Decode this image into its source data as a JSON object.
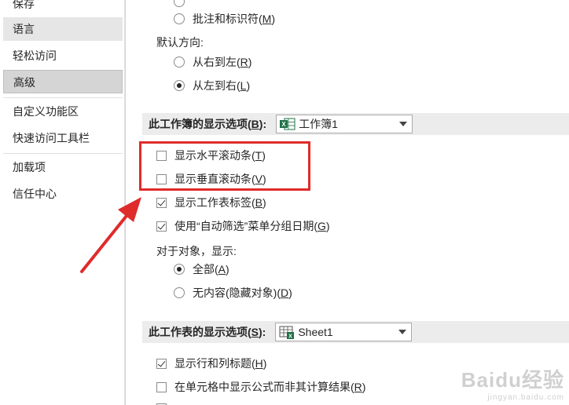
{
  "sidebar": {
    "items": [
      {
        "label": "保存"
      },
      {
        "label": "语言"
      },
      {
        "label": "轻松访问"
      },
      {
        "label": "高级"
      },
      {
        "label": "自定义功能区"
      },
      {
        "label": "快速访问工具栏"
      },
      {
        "label": "加载项"
      },
      {
        "label": "信任中心"
      }
    ]
  },
  "main": {
    "comments_option": {
      "label": "批注和标识符(",
      "key": "M",
      "suffix": ")",
      "selected": false
    },
    "default_direction_label": "默认方向:",
    "direction_rtl": {
      "label": "从右到左(",
      "key": "R",
      "suffix": ")",
      "selected": false
    },
    "direction_ltr": {
      "label": "从左到右(",
      "key": "L",
      "suffix": ")",
      "selected": true
    },
    "workbook_section": {
      "label": "此工作簿的显示选项(",
      "key": "B",
      "suffix": "):",
      "selected_value": "工作簿1"
    },
    "show_hscroll": {
      "label": "显示水平滚动条(",
      "key": "T",
      "suffix": ")",
      "checked": false
    },
    "show_vscroll": {
      "label": "显示垂直滚动条(",
      "key": "V",
      "suffix": ")",
      "checked": false
    },
    "show_sheet_tabs": {
      "label": "显示工作表标签(",
      "key": "B",
      "suffix": ")",
      "checked": true
    },
    "group_dates": {
      "label": "使用“自动筛选”菜单分组日期(",
      "key": "G",
      "suffix": ")",
      "checked": true
    },
    "objects_label": "对于对象，显示:",
    "objects_all": {
      "label": "全部(",
      "key": "A",
      "suffix": ")",
      "selected": true
    },
    "objects_none": {
      "label": "无内容(隐藏对象)(",
      "key": "D",
      "suffix": ")",
      "selected": false
    },
    "worksheet_section": {
      "label": "此工作表的显示选项(",
      "key": "S",
      "suffix": "):",
      "selected_value": "Sheet1"
    },
    "show_headers": {
      "label": "显示行和列标题(",
      "key": "H",
      "suffix": ")",
      "checked": true
    },
    "show_formulas": {
      "label": "在单元格中显示公式而非其计算结果(",
      "key": "R",
      "suffix": ")",
      "checked": false
    }
  },
  "colors": {
    "annotation_red": "#e02b2b",
    "excel_green": "#1e7145"
  },
  "watermark": {
    "brand": "Baidu经验",
    "url": "jingyan.baidu.com"
  }
}
